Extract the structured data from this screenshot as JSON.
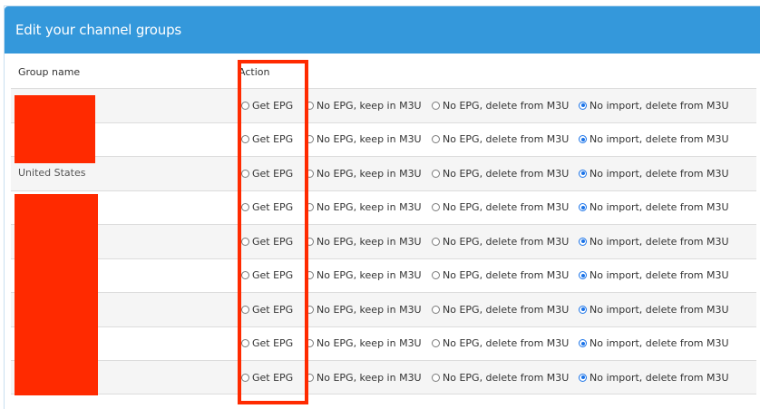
{
  "header": {
    "title": "Edit your channel groups"
  },
  "table": {
    "columns": {
      "group_name": "Group name",
      "action": "Action"
    },
    "options": [
      "Get EPG",
      "No EPG, keep in M3U",
      "No EPG, delete from M3U",
      "No import, delete from M3U"
    ],
    "rows": [
      {
        "group": "",
        "selected": "No import, delete from M3U"
      },
      {
        "group": "",
        "selected": "No import, delete from M3U"
      },
      {
        "group": "United States",
        "selected": "No import, delete from M3U"
      },
      {
        "group": "",
        "selected": "No import, delete from M3U"
      },
      {
        "group": "",
        "selected": "No import, delete from M3U"
      },
      {
        "group": "",
        "selected": "No import, delete from M3U"
      },
      {
        "group": "",
        "selected": "No import, delete from M3U"
      },
      {
        "group": "",
        "selected": "No import, delete from M3U"
      },
      {
        "group": "",
        "selected": "No import, delete from M3U"
      }
    ]
  },
  "colors": {
    "header_bg": "#3498db",
    "redaction": "#ff2a00",
    "radio_checked": "#1a73e8"
  }
}
